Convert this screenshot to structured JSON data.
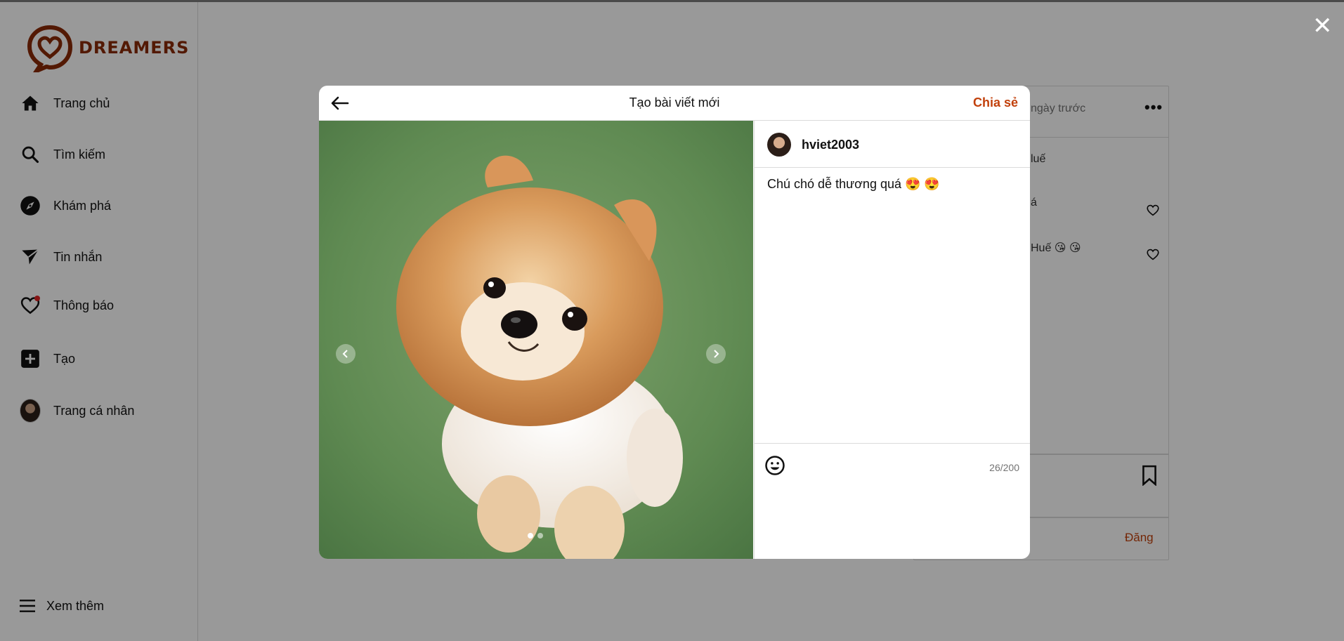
{
  "brand": {
    "name": "DREAMERS",
    "color": "#8a2a08"
  },
  "sidebar": {
    "items": [
      {
        "label": "Trang chủ",
        "icon": "home-icon"
      },
      {
        "label": "Tìm kiếm",
        "icon": "search-icon"
      },
      {
        "label": "Khám phá",
        "icon": "compass-icon"
      },
      {
        "label": "Tin nhắn",
        "icon": "send-icon"
      },
      {
        "label": "Thông báo",
        "icon": "heart-icon"
      },
      {
        "label": "Tạo",
        "icon": "plus-square-icon"
      },
      {
        "label": "Trang cá nhân",
        "icon": "avatar"
      }
    ],
    "more": {
      "label": "Xem thêm",
      "icon": "menu-icon"
    }
  },
  "feed_card": {
    "time_fragment": "ngày trước",
    "line1": "luế",
    "line2": "á",
    "line3": "Huế 😘 😘",
    "post_button": "Đăng"
  },
  "modal": {
    "title": "Tạo bài viết mới",
    "share_label": "Chia sẻ",
    "username": "hviet2003",
    "caption": "Chú chó dễ thương quá 😍 😍",
    "char_count": "26/200",
    "image_count": 2,
    "active_image_index": 0
  },
  "colors": {
    "accent": "#c2410c",
    "overlay": "rgba(0,0,0,0.4)"
  }
}
